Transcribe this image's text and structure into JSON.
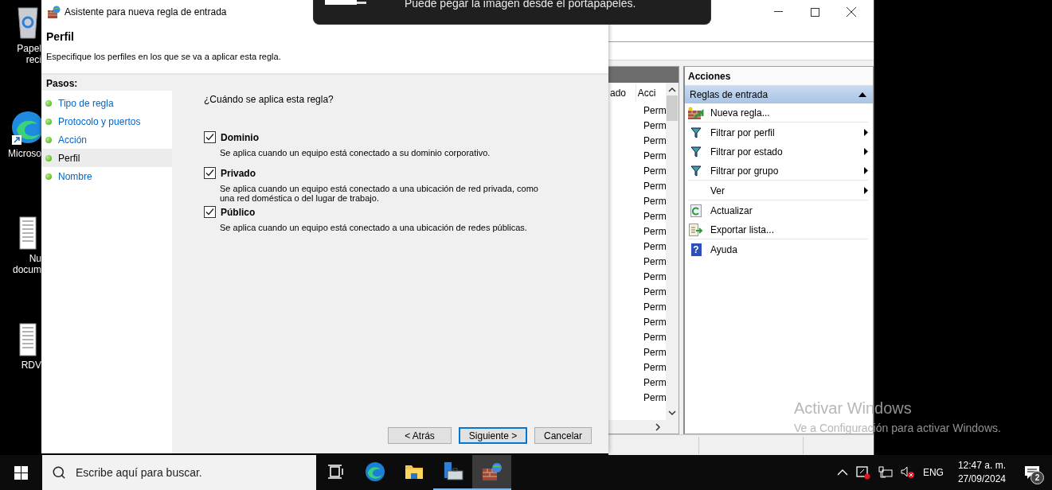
{
  "desktop_icons": [
    {
      "kind": "recycle",
      "lines": [
        "Papel",
        "reci"
      ]
    },
    {
      "kind": "edge",
      "lines": [
        "Microso"
      ]
    },
    {
      "kind": "document",
      "lines": [
        "Nu",
        "docum"
      ]
    },
    {
      "kind": "document",
      "lines": [
        "RDV"
      ]
    }
  ],
  "toast": {
    "message": "Puede pegar la imagen desde el portapapeles."
  },
  "mmc": {
    "list": {
      "columns": [
        "ado",
        "Acci"
      ],
      "rows": [
        "Perm",
        "Perm",
        "Perm",
        "Perm",
        "Perm",
        "Perm",
        "Perm",
        "Perm",
        "Perm",
        "Perm",
        "Perm",
        "Perm",
        "Perm",
        "Perm",
        "Perm",
        "Perm",
        "Perm",
        "Perm",
        "Perm",
        "Perm"
      ]
    },
    "actions": {
      "title": "Acciones",
      "section": {
        "label": "Reglas de entrada",
        "expanded": true
      },
      "items": [
        {
          "label": "Nueva regla...",
          "kind": "new",
          "submenu": false
        },
        {
          "label": "Filtrar por perfil",
          "kind": "filter",
          "submenu": true
        },
        {
          "label": "Filtrar por estado",
          "kind": "filter",
          "submenu": true
        },
        {
          "label": "Filtrar por grupo",
          "kind": "filter",
          "submenu": true
        },
        {
          "label": "Ver",
          "kind": "plain",
          "submenu": true
        },
        {
          "label": "Actualizar",
          "kind": "refresh",
          "submenu": false
        },
        {
          "label": "Exportar lista...",
          "kind": "export",
          "submenu": false
        },
        {
          "label": "Ayuda",
          "kind": "help",
          "glyph": "?",
          "submenu": false
        }
      ]
    }
  },
  "dialog": {
    "title": "Asistente para nueva regla de entrada",
    "heading": "Perfil",
    "subtitle": "Especifique los perfiles en los que se va a aplicar esta regla.",
    "steps_title": "Pasos:",
    "steps": [
      {
        "label": "Tipo de regla",
        "selected": false
      },
      {
        "label": "Protocolo y puertos",
        "selected": false
      },
      {
        "label": "Acción",
        "selected": false
      },
      {
        "label": "Perfil",
        "selected": true
      },
      {
        "label": "Nombre",
        "selected": false
      }
    ],
    "question": "¿Cuándo se aplica esta regla?",
    "profiles": [
      {
        "name": "Dominio",
        "checked": true,
        "description": "Se aplica cuando un equipo está conectado a su dominio corporativo."
      },
      {
        "name": "Privado",
        "checked": true,
        "description": "Se aplica cuando un equipo está conectado a una ubicación de red privada, como una red doméstica o del lugar de trabajo."
      },
      {
        "name": "Público",
        "checked": true,
        "description": "Se aplica cuando un equipo está conectado a una ubicación de redes públicas."
      }
    ],
    "buttons": [
      {
        "label": "< Atrás",
        "focused": false
      },
      {
        "label": "Siguiente >",
        "focused": true
      },
      {
        "label": "Cancelar",
        "focused": false
      }
    ]
  },
  "activation": {
    "title": "Activar Windows",
    "subtitle": "Ve a Configuración para activar Windows."
  },
  "taskbar": {
    "search": {
      "placeholder": "Escribe aquí para buscar."
    },
    "apps": [
      {
        "kind": "taskview",
        "running": false,
        "active": false
      },
      {
        "kind": "browser",
        "running": false,
        "active": false
      },
      {
        "kind": "folder",
        "running": false,
        "active": false
      },
      {
        "kind": "server",
        "running": true,
        "active": false
      },
      {
        "kind": "firewall",
        "running": true,
        "active": true
      }
    ],
    "language": "ENG",
    "time": "12:47 a. m.",
    "date": "27/09/2024",
    "notifications": "2"
  }
}
